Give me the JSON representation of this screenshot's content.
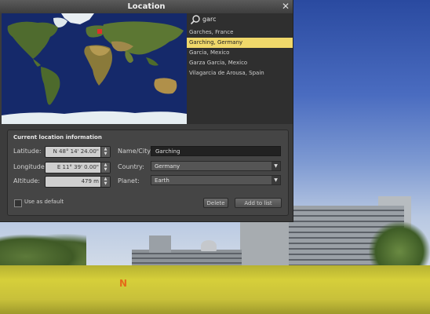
{
  "dialog": {
    "title": "Location"
  },
  "search": {
    "value": "garc"
  },
  "results": [
    {
      "label": "Garches, France",
      "selected": false
    },
    {
      "label": "Garching, Germany",
      "selected": true
    },
    {
      "label": "Garcia, Mexico",
      "selected": false
    },
    {
      "label": "Garza Garcia, Mexico",
      "selected": false
    },
    {
      "label": "Vilagarcia de Arousa, Spain",
      "selected": false
    }
  ],
  "info": {
    "title": "Current location information",
    "latitude_label": "Latitude:",
    "latitude_value": "N 48° 14' 24.00\"",
    "longitude_label": "Longitude:",
    "longitude_value": "E 11° 39' 0.00\"",
    "altitude_label": "Altitude:",
    "altitude_value": "479 m",
    "name_label": "Name/City:",
    "name_value": "Garching",
    "country_label": "Country:",
    "country_value": "Germany",
    "planet_label": "Planet:",
    "planet_value": "Earth",
    "default_label": "Use as default",
    "delete_label": "Delete",
    "add_label": "Add to list"
  },
  "compass": {
    "north": "N"
  },
  "colors": {
    "selection": "#f0d86a",
    "marker": "#e0302a"
  }
}
